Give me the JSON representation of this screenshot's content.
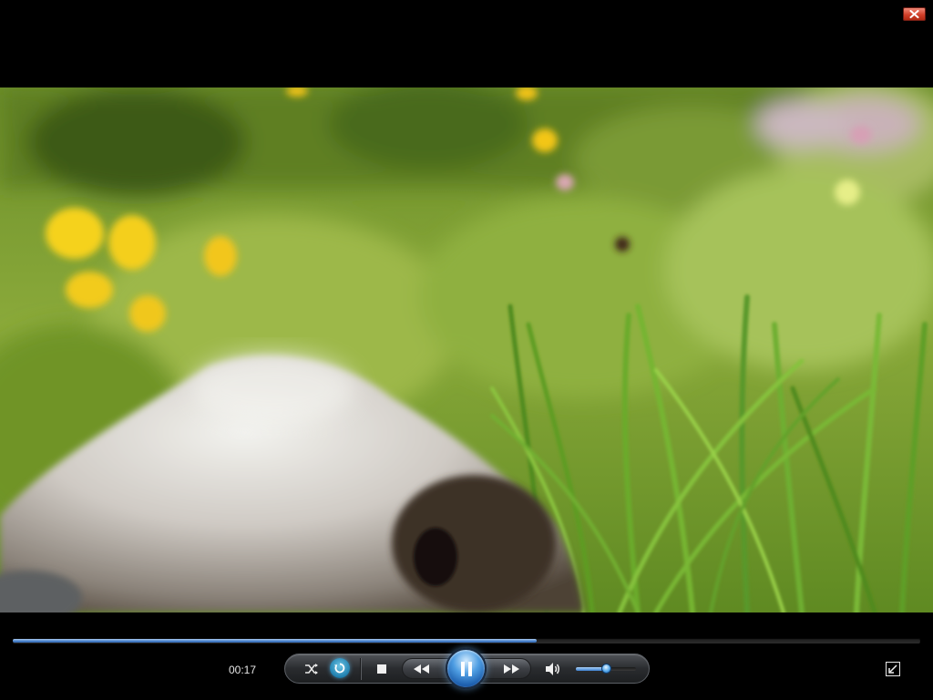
{
  "player": {
    "elapsed_time": "00:17",
    "progress_fraction": 0.577,
    "volume_fraction": 0.5,
    "state": "playing"
  },
  "icons": {
    "close": "close-icon",
    "shuffle": "shuffle-icon",
    "repeat": "repeat-icon",
    "stop": "stop-icon",
    "rewind": "rewind-icon",
    "play_pause": "pause-icon",
    "fast_forward": "fast-forward-icon",
    "volume": "speaker-icon",
    "fullscreen": "exit-fullscreen-icon"
  },
  "colors": {
    "accent": "#4d86cf",
    "close_button": "#d2402a",
    "play_button": "#4e9de2"
  }
}
